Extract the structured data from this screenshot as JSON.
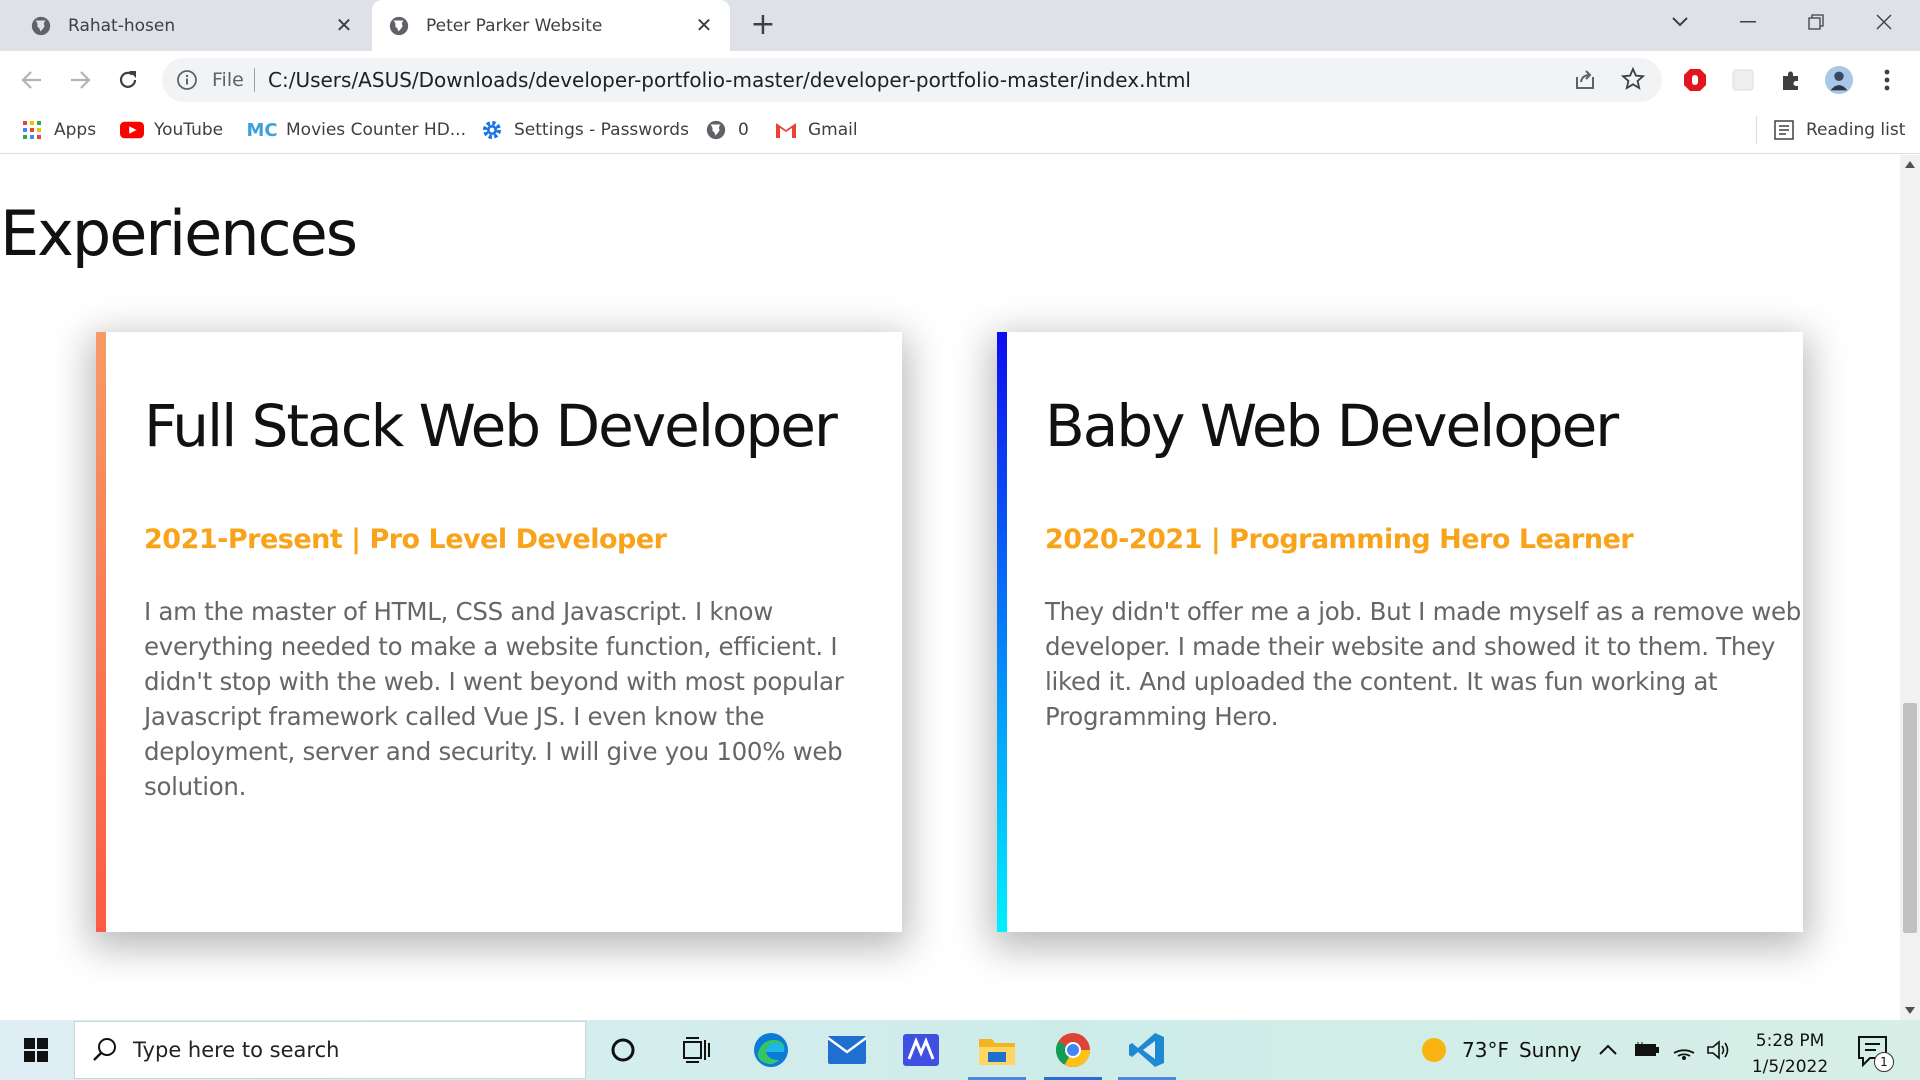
{
  "browser": {
    "tabs": [
      {
        "title": "Rahat-hosen",
        "active": false
      },
      {
        "title": "Peter Parker Website",
        "active": true
      }
    ],
    "new_tab_label": "+",
    "address": {
      "scheme_label": "File",
      "url": "C:/Users/ASUS/Downloads/developer-portfolio-master/developer-portfolio-master/index.html"
    },
    "bookmarks": [
      {
        "label": "Apps",
        "icon": "apps-grid-icon"
      },
      {
        "label": "YouTube",
        "icon": "youtube-icon"
      },
      {
        "label": "Movies Counter HD...",
        "icon": "mc-icon"
      },
      {
        "label": "Settings - Passwords",
        "icon": "gear-icon"
      },
      {
        "label": "0",
        "icon": "globe-icon"
      },
      {
        "label": "Gmail",
        "icon": "gmail-icon"
      }
    ],
    "reading_list_label": "Reading list"
  },
  "page": {
    "section_title": "Experiences",
    "cards": [
      {
        "title": "Full Stack Web Developer",
        "subtitle": "2021-Present | Pro Level Developer",
        "description": "I am the master of HTML, CSS and Javascript. I know everything needed to make a website function, efficient. I didn't stop with the web. I went beyond with most popular Javascript framework called Vue JS. I even know the deployment, server and security. I will give you 100% web solution.",
        "accent_gradient": [
          "#f79a66",
          "#fb5b44"
        ]
      },
      {
        "title": "Baby Web Developer",
        "subtitle": "2020-2021 | Programming Hero Learner",
        "description": "They didn't offer me a job. But I made myself as a remove web developer. I made their website and showed it to them. They liked it. And uploaded the content. It was fun working at Programming Hero.",
        "accent_gradient": [
          "#0c0cf0",
          "#00f0ff"
        ]
      }
    ],
    "subtitle_color": "#f9a31a"
  },
  "taskbar": {
    "search_placeholder": "Type here to search",
    "weather": {
      "temp": "73°F",
      "condition": "Sunny"
    },
    "time": "5:28 PM",
    "date": "1/5/2022",
    "notification_count": "1"
  }
}
